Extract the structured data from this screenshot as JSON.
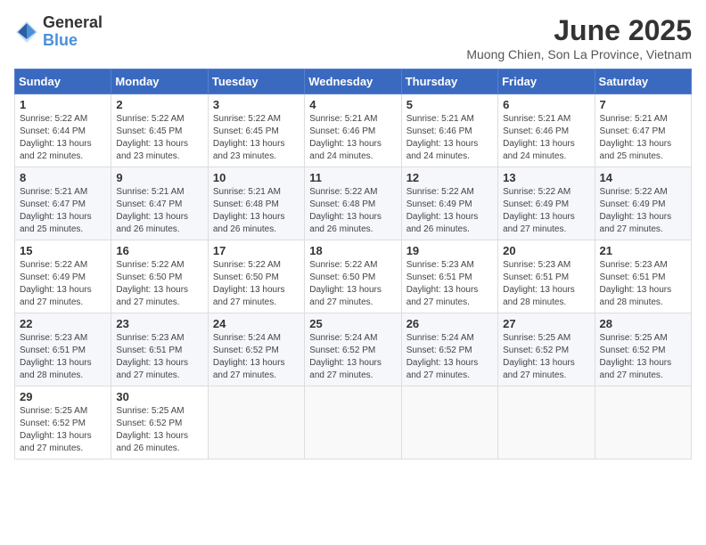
{
  "logo": {
    "general": "General",
    "blue": "Blue"
  },
  "header": {
    "month": "June 2025",
    "location": "Muong Chien, Son La Province, Vietnam"
  },
  "weekdays": [
    "Sunday",
    "Monday",
    "Tuesday",
    "Wednesday",
    "Thursday",
    "Friday",
    "Saturday"
  ],
  "weeks": [
    [
      {
        "day": 1,
        "sunrise": "5:22 AM",
        "sunset": "6:44 PM",
        "daylight": "13 hours and 22 minutes."
      },
      {
        "day": 2,
        "sunrise": "5:22 AM",
        "sunset": "6:45 PM",
        "daylight": "13 hours and 23 minutes."
      },
      {
        "day": 3,
        "sunrise": "5:22 AM",
        "sunset": "6:45 PM",
        "daylight": "13 hours and 23 minutes."
      },
      {
        "day": 4,
        "sunrise": "5:21 AM",
        "sunset": "6:46 PM",
        "daylight": "13 hours and 24 minutes."
      },
      {
        "day": 5,
        "sunrise": "5:21 AM",
        "sunset": "6:46 PM",
        "daylight": "13 hours and 24 minutes."
      },
      {
        "day": 6,
        "sunrise": "5:21 AM",
        "sunset": "6:46 PM",
        "daylight": "13 hours and 24 minutes."
      },
      {
        "day": 7,
        "sunrise": "5:21 AM",
        "sunset": "6:47 PM",
        "daylight": "13 hours and 25 minutes."
      }
    ],
    [
      {
        "day": 8,
        "sunrise": "5:21 AM",
        "sunset": "6:47 PM",
        "daylight": "13 hours and 25 minutes."
      },
      {
        "day": 9,
        "sunrise": "5:21 AM",
        "sunset": "6:47 PM",
        "daylight": "13 hours and 26 minutes."
      },
      {
        "day": 10,
        "sunrise": "5:21 AM",
        "sunset": "6:48 PM",
        "daylight": "13 hours and 26 minutes."
      },
      {
        "day": 11,
        "sunrise": "5:22 AM",
        "sunset": "6:48 PM",
        "daylight": "13 hours and 26 minutes."
      },
      {
        "day": 12,
        "sunrise": "5:22 AM",
        "sunset": "6:49 PM",
        "daylight": "13 hours and 26 minutes."
      },
      {
        "day": 13,
        "sunrise": "5:22 AM",
        "sunset": "6:49 PM",
        "daylight": "13 hours and 27 minutes."
      },
      {
        "day": 14,
        "sunrise": "5:22 AM",
        "sunset": "6:49 PM",
        "daylight": "13 hours and 27 minutes."
      }
    ],
    [
      {
        "day": 15,
        "sunrise": "5:22 AM",
        "sunset": "6:49 PM",
        "daylight": "13 hours and 27 minutes."
      },
      {
        "day": 16,
        "sunrise": "5:22 AM",
        "sunset": "6:50 PM",
        "daylight": "13 hours and 27 minutes."
      },
      {
        "day": 17,
        "sunrise": "5:22 AM",
        "sunset": "6:50 PM",
        "daylight": "13 hours and 27 minutes."
      },
      {
        "day": 18,
        "sunrise": "5:22 AM",
        "sunset": "6:50 PM",
        "daylight": "13 hours and 27 minutes."
      },
      {
        "day": 19,
        "sunrise": "5:23 AM",
        "sunset": "6:51 PM",
        "daylight": "13 hours and 27 minutes."
      },
      {
        "day": 20,
        "sunrise": "5:23 AM",
        "sunset": "6:51 PM",
        "daylight": "13 hours and 28 minutes."
      },
      {
        "day": 21,
        "sunrise": "5:23 AM",
        "sunset": "6:51 PM",
        "daylight": "13 hours and 28 minutes."
      }
    ],
    [
      {
        "day": 22,
        "sunrise": "5:23 AM",
        "sunset": "6:51 PM",
        "daylight": "13 hours and 28 minutes."
      },
      {
        "day": 23,
        "sunrise": "5:23 AM",
        "sunset": "6:51 PM",
        "daylight": "13 hours and 27 minutes."
      },
      {
        "day": 24,
        "sunrise": "5:24 AM",
        "sunset": "6:52 PM",
        "daylight": "13 hours and 27 minutes."
      },
      {
        "day": 25,
        "sunrise": "5:24 AM",
        "sunset": "6:52 PM",
        "daylight": "13 hours and 27 minutes."
      },
      {
        "day": 26,
        "sunrise": "5:24 AM",
        "sunset": "6:52 PM",
        "daylight": "13 hours and 27 minutes."
      },
      {
        "day": 27,
        "sunrise": "5:25 AM",
        "sunset": "6:52 PM",
        "daylight": "13 hours and 27 minutes."
      },
      {
        "day": 28,
        "sunrise": "5:25 AM",
        "sunset": "6:52 PM",
        "daylight": "13 hours and 27 minutes."
      }
    ],
    [
      {
        "day": 29,
        "sunrise": "5:25 AM",
        "sunset": "6:52 PM",
        "daylight": "13 hours and 27 minutes."
      },
      {
        "day": 30,
        "sunrise": "5:25 AM",
        "sunset": "6:52 PM",
        "daylight": "13 hours and 26 minutes."
      },
      null,
      null,
      null,
      null,
      null
    ]
  ]
}
